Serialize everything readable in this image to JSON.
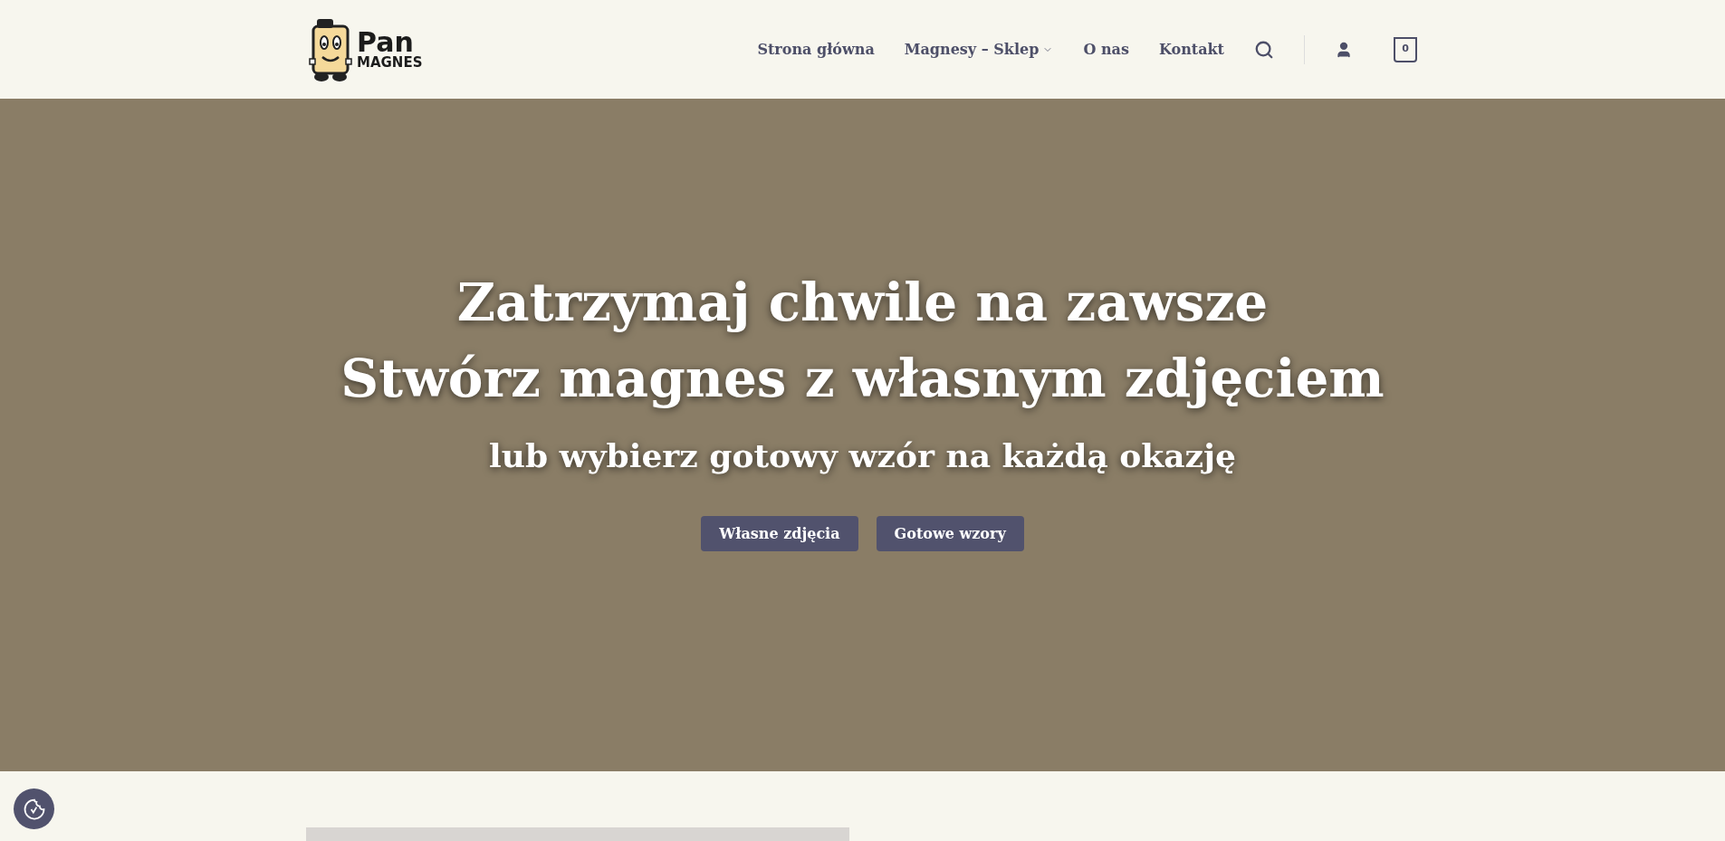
{
  "header": {
    "logo": {
      "word_1": "Pan",
      "word_2": "MAGNES"
    },
    "nav": [
      {
        "label": "Strona główna",
        "has_dropdown": false
      },
      {
        "label": "Magnesy – Sklep",
        "has_dropdown": true
      },
      {
        "label": "O nas",
        "has_dropdown": false
      },
      {
        "label": "Kontakt",
        "has_dropdown": false
      }
    ],
    "cart_count": "0"
  },
  "hero": {
    "title_lines": [
      "Zatrzymaj chwile na zawsze",
      "Stwórz magnes z własnym zdjęciem"
    ],
    "subtitle": "lub wybierz gotowy wzór na każdą okazję",
    "buttons": [
      "Własne zdjęcia",
      "Gotowe wzory"
    ]
  }
}
